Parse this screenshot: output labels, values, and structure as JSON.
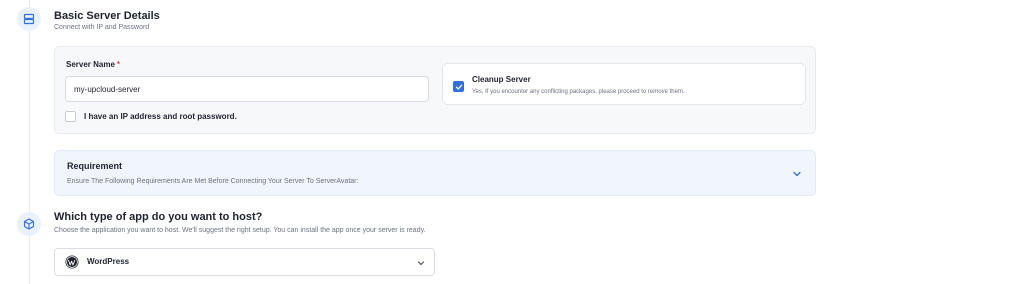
{
  "basic_server": {
    "title": "Basic Server Details",
    "subtitle": "Connect with IP and Password",
    "server_name": {
      "label": "Server Name",
      "required_marker": "*",
      "value": "my-upcloud-server"
    },
    "ip_checkbox": {
      "label": "I have an IP address and root password.",
      "checked": false
    },
    "cleanup": {
      "title": "Cleanup Server",
      "description": "Yes, If you encounter any conflicting packages, please proceed to remove them.",
      "checked": true
    }
  },
  "requirement": {
    "title": "Requirement",
    "subtitle": "Ensure The Following Requirements Are Met Before Connecting Your Server To ServerAvatar:"
  },
  "app_host": {
    "title": "Which type of app do you want to host?",
    "subtitle": "Choose the application you want to host. We'll suggest the right setup. You can install the app once your server is ready.",
    "selected": "WordPress"
  },
  "colors": {
    "accent": "#2f6fde",
    "required": "#e5484d",
    "step_icon_bg": "#e9f1fd"
  }
}
